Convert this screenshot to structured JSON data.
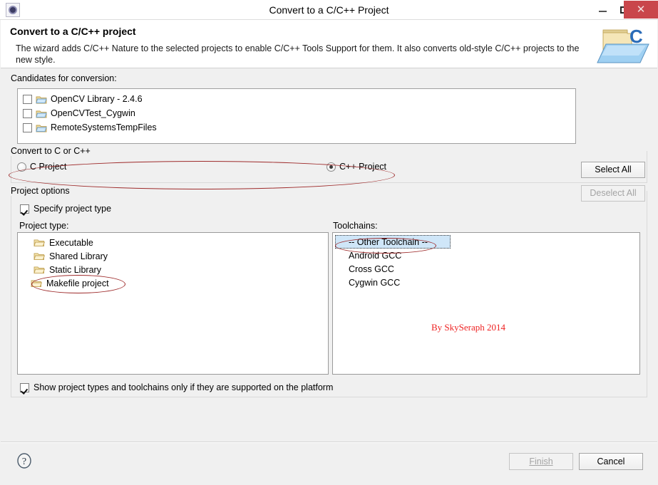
{
  "window": {
    "title": "Convert to a C/C++ Project",
    "app_icon": "eclipse-icon",
    "minimize_label": "",
    "maximize_label": "",
    "close_label": "✕"
  },
  "header": {
    "title": "Convert to a C/C++ project",
    "description": "The wizard adds C/C++ Nature to the selected projects to enable C/C++ Tools Support for them. It also converts old-style C/C++ projects to the new style.",
    "icon": "c-project-folder-icon"
  },
  "candidates": {
    "label": "Candidates for conversion:",
    "items": [
      {
        "label": "OpenCV Library - 2.4.6",
        "checked": false,
        "icon": "project-folder-icon"
      },
      {
        "label": "OpenCVTest_Cygwin",
        "checked": false,
        "icon": "project-folder-icon"
      },
      {
        "label": "RemoteSystemsTempFiles",
        "checked": false,
        "icon": "project-folder-icon"
      }
    ],
    "select_all_label": "Select All",
    "deselect_all_label": "Deselect All",
    "select_all_enabled": true,
    "deselect_all_enabled": false
  },
  "convert_group": {
    "label": "Convert to C or C++",
    "options": [
      {
        "label": "C Project",
        "selected": false
      },
      {
        "label": "C++ Project",
        "selected": true
      }
    ]
  },
  "project_options": {
    "label": "Project options",
    "specify_project_type": {
      "label": "Specify project type",
      "checked": true
    },
    "project_type_label": "Project type:",
    "project_types": [
      {
        "label": "Executable",
        "icon": "folder-icon",
        "selected": false
      },
      {
        "label": "Shared Library",
        "icon": "folder-icon",
        "selected": false
      },
      {
        "label": "Static Library",
        "icon": "folder-icon",
        "selected": false
      },
      {
        "label": "Makefile project",
        "icon": "folder-icon",
        "selected": false
      }
    ],
    "toolchains_label": "Toolchains:",
    "toolchains": [
      {
        "label": "-- Other Toolchain --",
        "selected": true
      },
      {
        "label": "Android GCC",
        "selected": false
      },
      {
        "label": "Cross GCC",
        "selected": false
      },
      {
        "label": "Cygwin GCC",
        "selected": false
      }
    ],
    "watermark": "By SkySeraph 2014",
    "show_supported_only": {
      "label": "Show project types and toolchains only if they are supported on the platform",
      "checked": true
    }
  },
  "footer": {
    "help_icon": "help-question-icon",
    "finish_label": "Finish",
    "finish_enabled": false,
    "cancel_label": "Cancel",
    "cancel_enabled": true
  },
  "colors": {
    "dialog_background": "#f0f0f0",
    "close_button": "#c9464b",
    "selection_highlight": "#cfe6f8",
    "annotation_red": "#9e2b2b",
    "watermark_red": "#ee2222"
  },
  "annotations": [
    {
      "name": "radio-group-highlight",
      "shape": "ellipse"
    },
    {
      "name": "makefile-project-highlight",
      "shape": "ellipse"
    },
    {
      "name": "other-toolchain-highlight",
      "shape": "ellipse"
    }
  ]
}
